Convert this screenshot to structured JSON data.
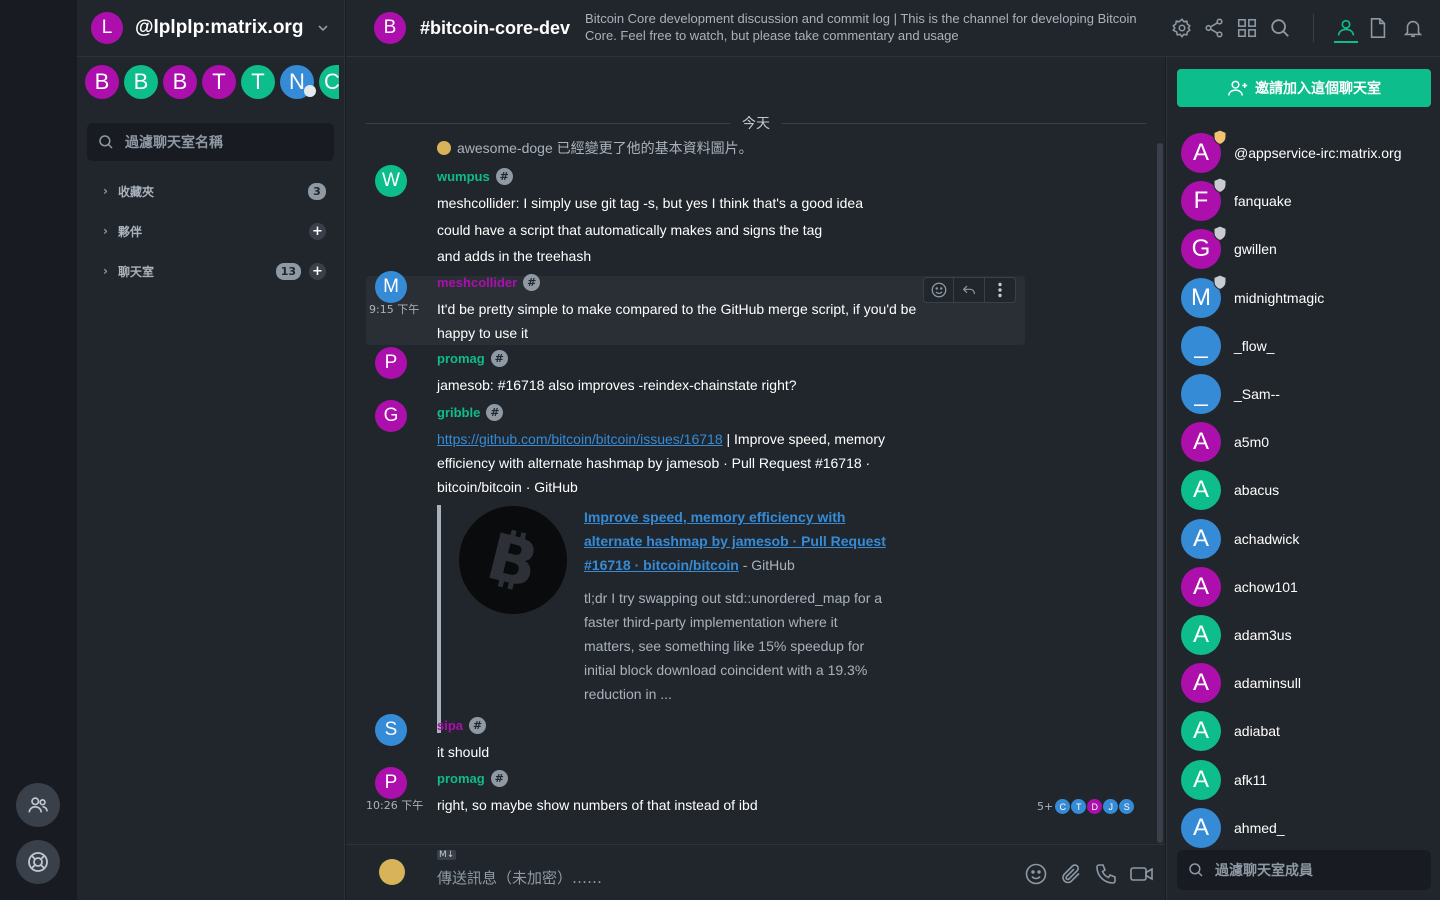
{
  "colors": {
    "accent": "#0dbd8b",
    "magenta": "#ac0fac",
    "green": "#0dbd8b",
    "blue": "#368bd6",
    "link": "#368bd6"
  },
  "user": {
    "initial": "L",
    "name": "@lplplp:matrix.org"
  },
  "recents": [
    "B",
    "B",
    "B",
    "T",
    "T",
    "N",
    "C"
  ],
  "room_filter": {
    "placeholder": "過濾聊天室名稱"
  },
  "sections": [
    {
      "label": "收藏夾",
      "badge": "3"
    },
    {
      "label": "夥伴",
      "badge": ""
    },
    {
      "label": "聊天室",
      "badge": "13"
    }
  ],
  "room": {
    "initial": "B",
    "name": "#bitcoin-core-dev",
    "topic": "Bitcoin Core development discussion and commit log | This is the channel for developing Bitcoin Core. Feel free to watch, but please take commentary and usage"
  },
  "timeline": {
    "date_separator": "今天",
    "profile_change": "awesome-doge 已經變更了他的基本資料圖片。",
    "messages": [
      {
        "initial": "W",
        "sender": "wumpus",
        "lines": [
          "meshcollider: I simply use git tag -s, but yes I think that's a good idea",
          "could have a script that automatically makes and signs the tag",
          "and adds in the treehash"
        ]
      },
      {
        "initial": "M",
        "sender": "meshcollider",
        "time": "9:15 下午",
        "lines": [
          "It'd be pretty simple to make compared to the GitHub merge script, if you'd be",
          "happy to use it"
        ]
      },
      {
        "initial": "P",
        "sender": "promag",
        "lines": [
          "jamesob: #16718 also improves -reindex-chainstate right?"
        ]
      },
      {
        "initial": "G",
        "sender": "gribble",
        "link": "https://github.com/bitcoin/bitcoin/issues/16718",
        "lines": [
          " | Improve speed, memory",
          "efficiency with alternate hashmap by jamesob · Pull Request #16718 ·",
          "bitcoin/bitcoin · GitHub"
        ]
      },
      {
        "initial": "S",
        "sender": "sipa",
        "lines": [
          "it should"
        ]
      },
      {
        "initial": "P",
        "sender": "promag",
        "time": "10:26 下午",
        "lines": [
          "right, so maybe show numbers of that instead of ibd"
        ]
      }
    ],
    "preview": {
      "title_lines": [
        "Improve speed, memory efficiency with",
        "alternate hashmap by jamesob · Pull Request",
        "#16718 · bitcoin/bitcoin"
      ],
      "site": " - GitHub",
      "desc_lines": [
        "tl;dr I try swapping out std::unordered_map for a",
        "faster third-party implementation where it",
        "matters, see something like 15% speedup for",
        "initial block download coincident with a 19.3%",
        "reduction in ..."
      ]
    },
    "read_receipts": {
      "count": "5+",
      "initials": [
        "C",
        "T",
        "D",
        "J",
        "S"
      ]
    }
  },
  "composer": {
    "placeholder": "傳送訊息（未加密）……",
    "md_label": "M↓"
  },
  "members": {
    "invite_label": "邀請加入這個聊天室",
    "filter_placeholder": "過濾聊天室成員",
    "list": [
      {
        "initial": "A",
        "name": "@appservice-irc:matrix.org",
        "color": "#ac0fac",
        "badge": "gold"
      },
      {
        "initial": "F",
        "name": "fanquake",
        "color": "#ac0fac",
        "badge": "silver"
      },
      {
        "initial": "G",
        "name": "gwillen",
        "color": "#ac0fac",
        "badge": "silver"
      },
      {
        "initial": "M",
        "name": "midnightmagic",
        "color": "#368bd6",
        "badge": "silver"
      },
      {
        "initial": "_",
        "name": "_flow_",
        "color": "#368bd6",
        "badge": ""
      },
      {
        "initial": "_",
        "name": "_Sam--",
        "color": "#368bd6",
        "badge": ""
      },
      {
        "initial": "A",
        "name": "a5m0",
        "color": "#ac0fac",
        "badge": ""
      },
      {
        "initial": "A",
        "name": "abacus",
        "color": "#0dbd8b",
        "badge": ""
      },
      {
        "initial": "A",
        "name": "achadwick",
        "color": "#368bd6",
        "badge": ""
      },
      {
        "initial": "A",
        "name": "achow101",
        "color": "#ac0fac",
        "badge": ""
      },
      {
        "initial": "A",
        "name": "adam3us",
        "color": "#0dbd8b",
        "badge": ""
      },
      {
        "initial": "A",
        "name": "adaminsull",
        "color": "#ac0fac",
        "badge": ""
      },
      {
        "initial": "A",
        "name": "adiabat",
        "color": "#0dbd8b",
        "badge": ""
      },
      {
        "initial": "A",
        "name": "afk11",
        "color": "#0dbd8b",
        "badge": ""
      },
      {
        "initial": "A",
        "name": "ahmed_",
        "color": "#368bd6",
        "badge": ""
      }
    ]
  }
}
